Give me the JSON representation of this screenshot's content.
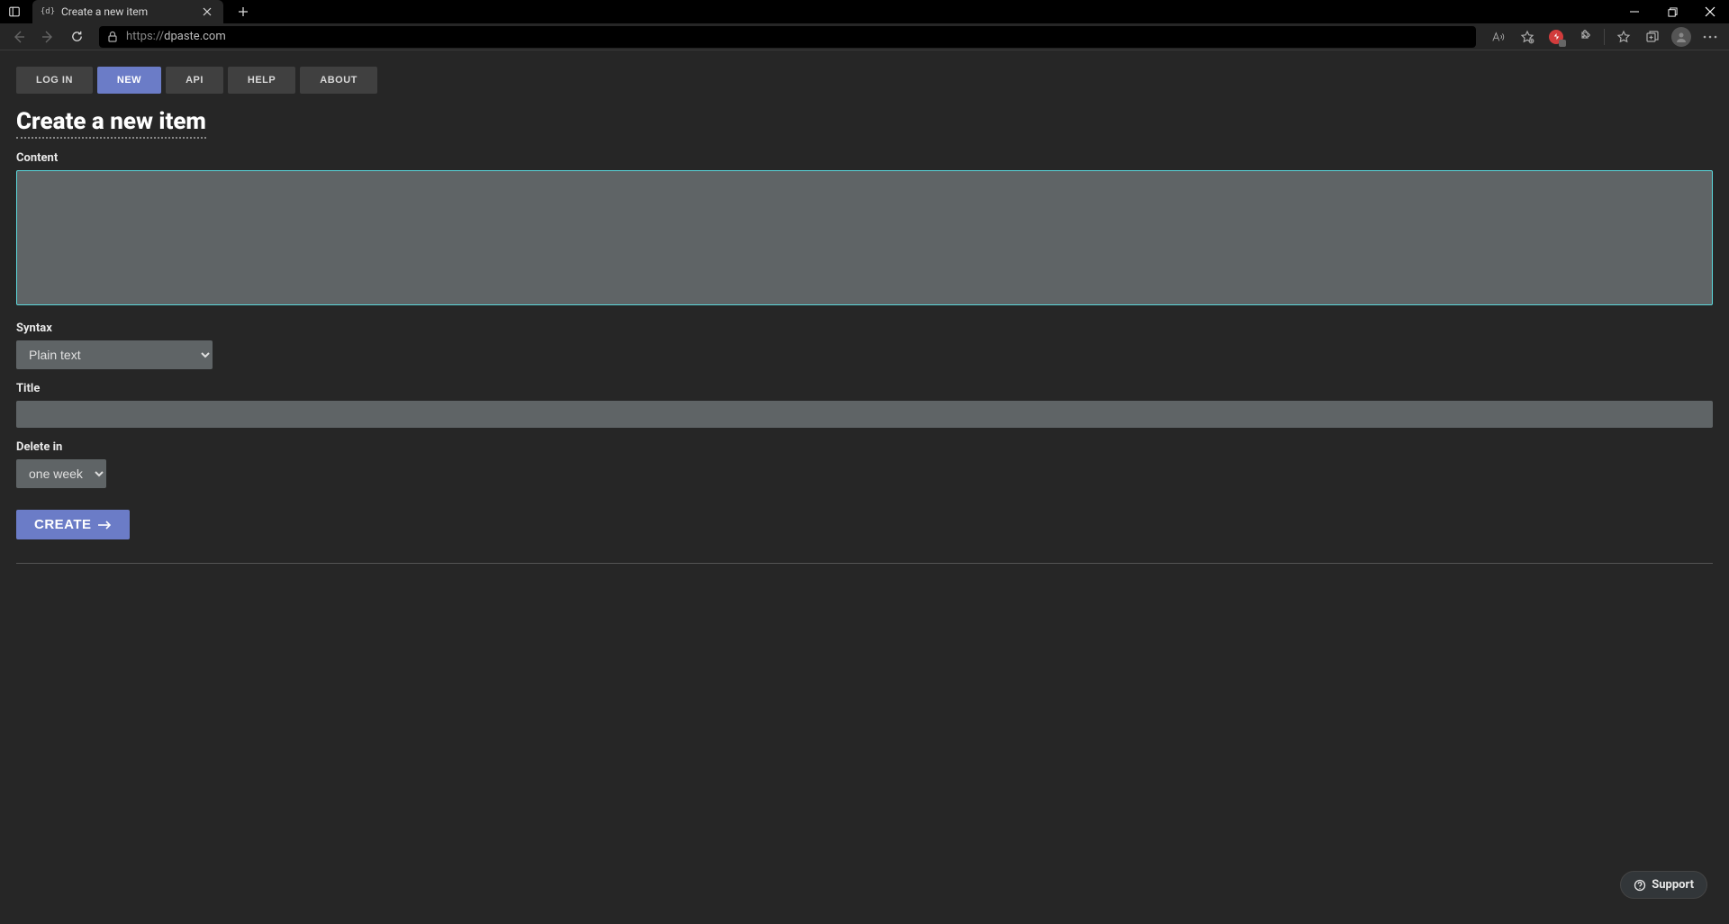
{
  "browser": {
    "tab_title": "Create a new item",
    "url_protocol": "https://",
    "url_host": "dpaste.com"
  },
  "nav": {
    "items": [
      {
        "label": "LOG IN"
      },
      {
        "label": "NEW"
      },
      {
        "label": "API"
      },
      {
        "label": "HELP"
      },
      {
        "label": "ABOUT"
      }
    ]
  },
  "page": {
    "title": "Create a new item",
    "labels": {
      "content": "Content",
      "syntax": "Syntax",
      "title": "Title",
      "delete_in": "Delete in"
    },
    "syntax_value": "Plain text",
    "delete_in_value": "one week",
    "submit_label": "CREATE"
  },
  "support": {
    "label": "Support"
  }
}
